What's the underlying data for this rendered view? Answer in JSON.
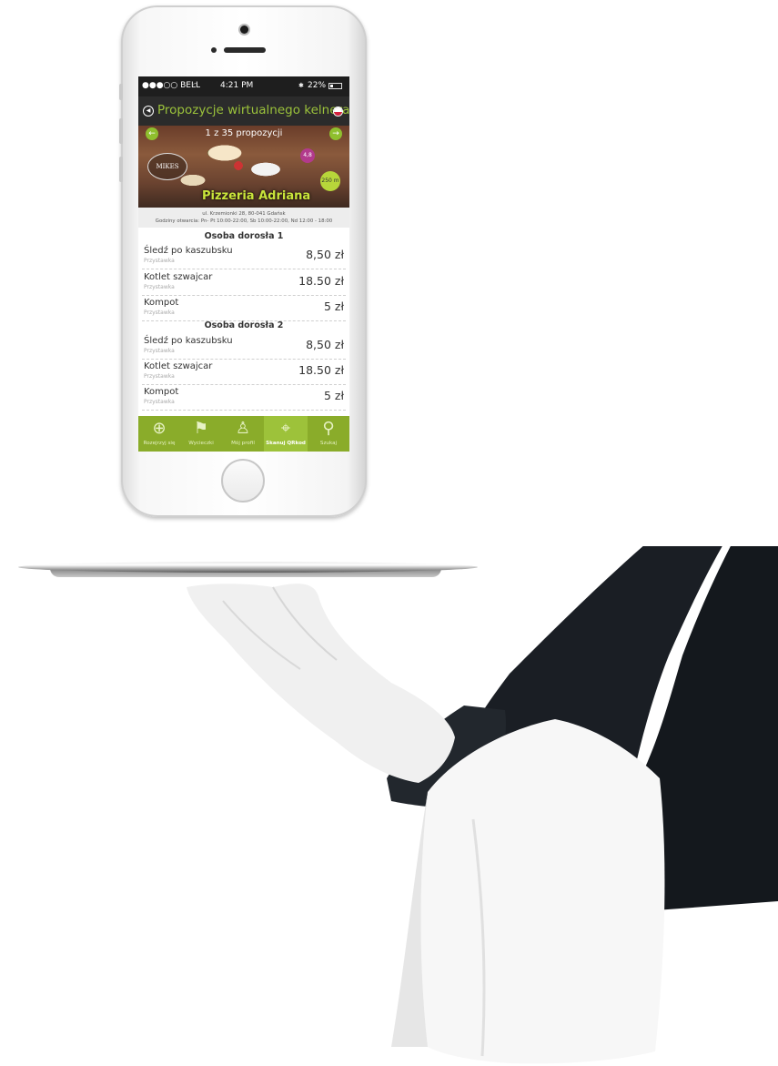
{
  "status_bar": {
    "carrier": "●●●○○ BELL",
    "time": "4:21 PM",
    "battery": "22%"
  },
  "header": {
    "title": "Propozycje wirtualnego kelnera"
  },
  "hero": {
    "pager": "1 z 35 propozycji",
    "logo": "MIKES",
    "rating": "4,8",
    "distance": "250 m",
    "restaurant_name": "Pizzeria Adriana"
  },
  "address": {
    "line1": "ul. Krzemionki 28, 80-041 Gdańsk",
    "line2": "Godziny otwarcia: Pn- Pt 10:00-22:00, Sb 10:00-22:00, Nd 12:00 - 18:00"
  },
  "sections": [
    {
      "title": "Osoba dorosła 1",
      "items": [
        {
          "name": "Śledź po kaszubsku",
          "category": "Przystawka",
          "price": "8,50 zł"
        },
        {
          "name": "Kotlet szwajcar",
          "category": "Przystawka",
          "price": "18.50 zł"
        },
        {
          "name": "Kompot",
          "category": "Przystawka",
          "price": "5 zł"
        }
      ]
    },
    {
      "title": "Osoba dorosła 2",
      "items": [
        {
          "name": "Śledź po kaszubsku",
          "category": "Przystawka",
          "price": "8,50 zł"
        },
        {
          "name": "Kotlet szwajcar",
          "category": "Przystawka",
          "price": "18.50 zł"
        },
        {
          "name": "Kompot",
          "category": "Przystawka",
          "price": "5 zł"
        }
      ]
    }
  ],
  "tabs": [
    {
      "label": "Rozejrzyj się",
      "icon": "globe-icon",
      "glyph": "⊕"
    },
    {
      "label": "Wycieczki",
      "icon": "signpost-icon",
      "glyph": "⚑"
    },
    {
      "label": "Mój profil",
      "icon": "user-icon",
      "glyph": "♙"
    },
    {
      "label": "Skanuj QRkod",
      "icon": "crosshair-icon",
      "glyph": "⌖"
    },
    {
      "label": "Szukaj",
      "icon": "search-icon",
      "glyph": "⚲"
    }
  ],
  "colors": {
    "accent_green": "#9bc23b",
    "tabbar_green": "#8aac2a",
    "header_dark": "#2b2b2b",
    "rating_badge": "#b23a8c",
    "distance_badge": "#b7d63a"
  }
}
